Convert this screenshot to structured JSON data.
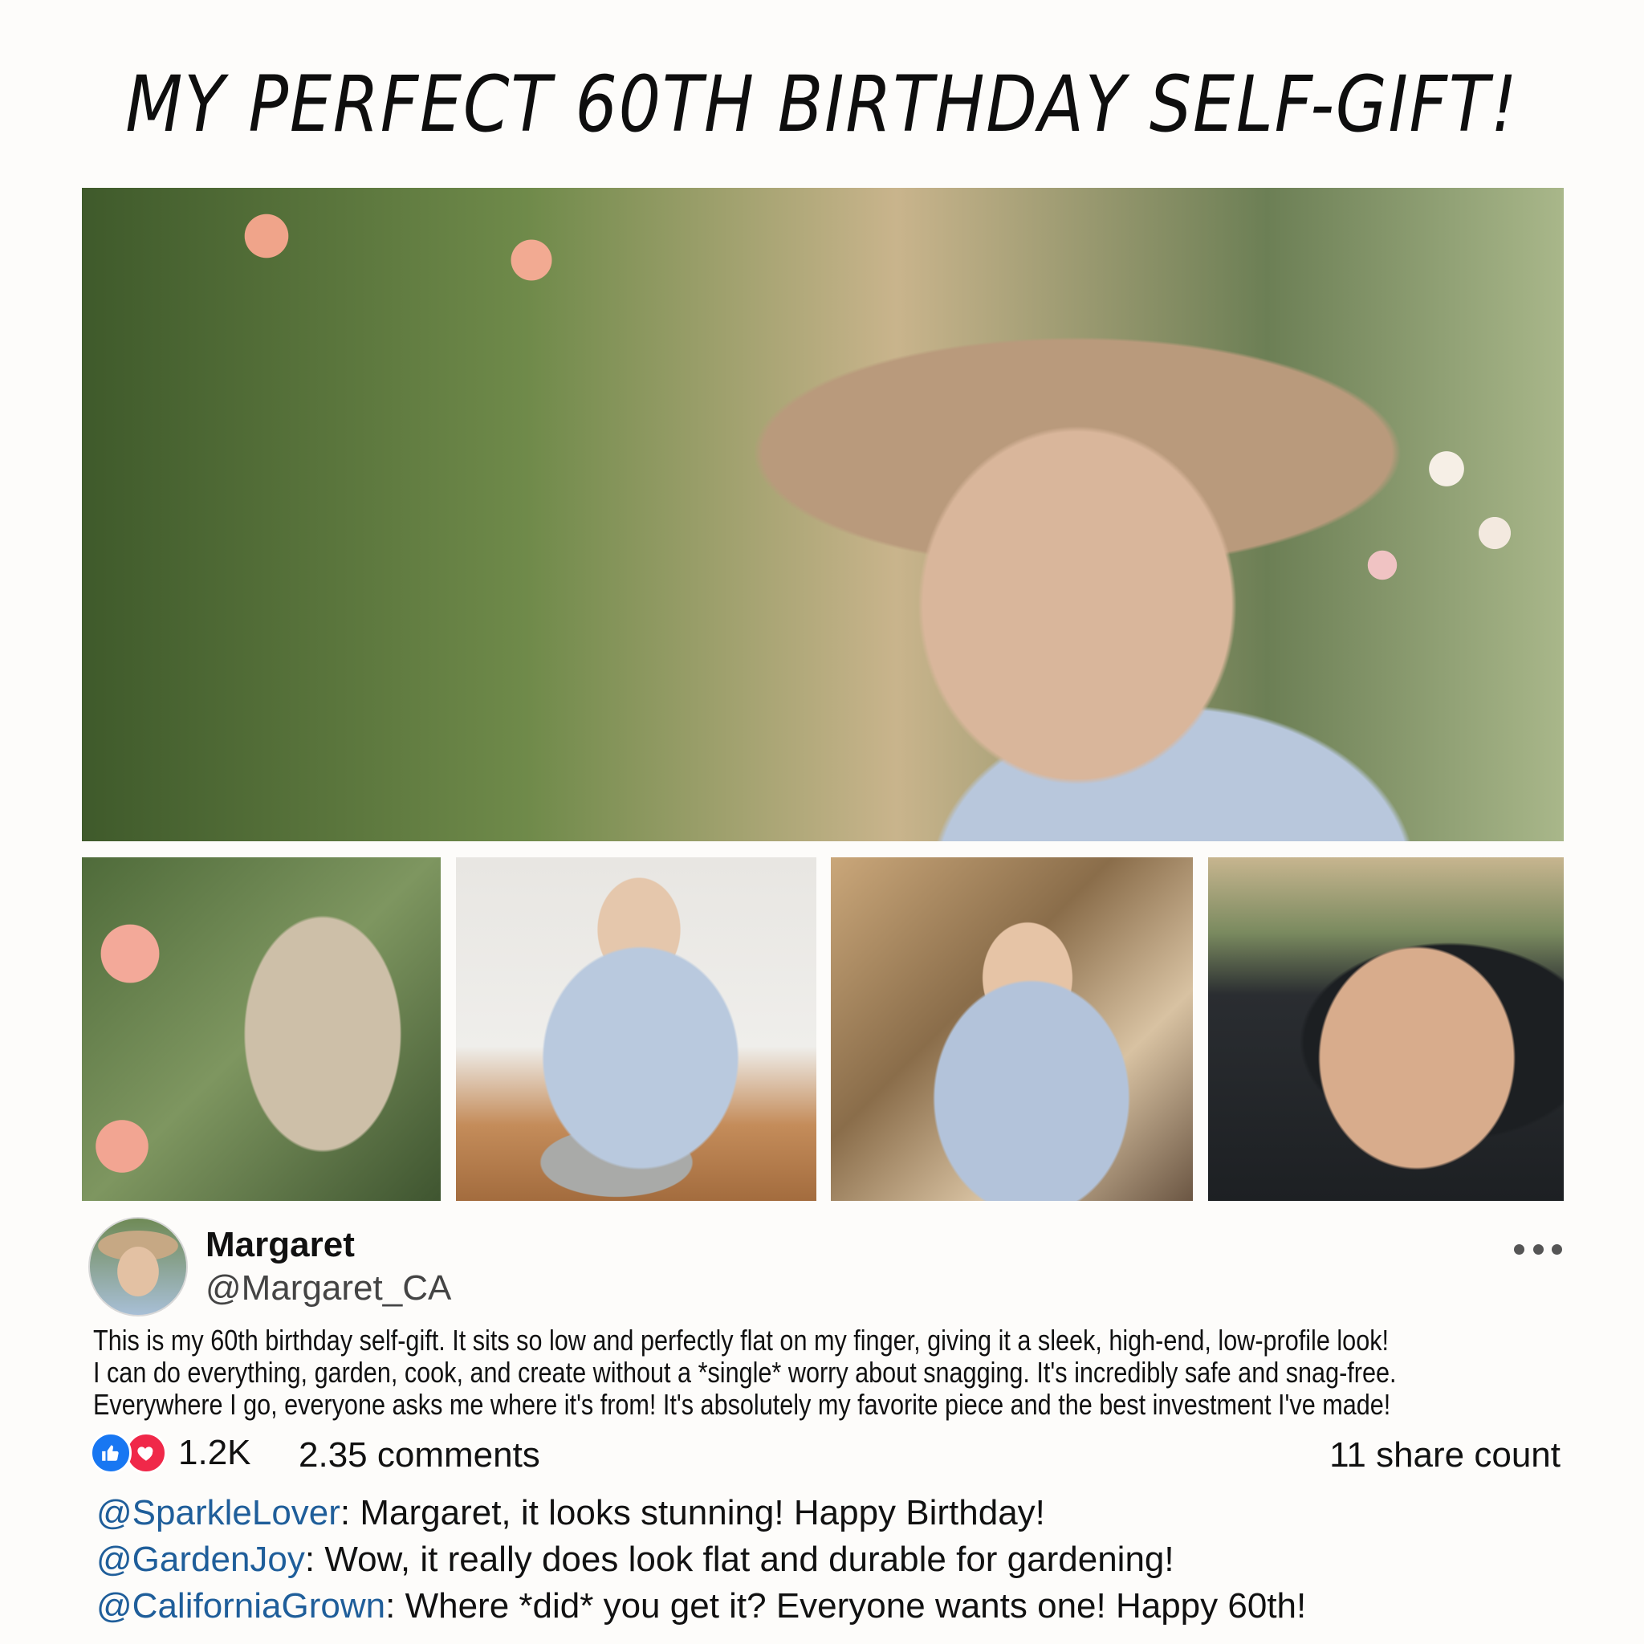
{
  "title": "MY PERFECT 60TH BIRTHDAY SELF-GIFT!",
  "post": {
    "author_name": "Margaret",
    "author_handle": "@Margaret_CA",
    "caption_lines": [
      "This is my 60th birthday self-gift. It sits so low and perfectly flat on my finger, giving it a sleek, high-end, low-profile look!",
      "I can do everything, garden, cook, and create without a *single* worry about snagging. It's incredibly safe and snag-free.",
      "Everywhere I go, everyone asks me where it's from! It's absolutely my favorite piece and the best investment I've made!"
    ],
    "likes": "1.2K",
    "comments_count": "2.35 comments",
    "shares": "11 share count"
  },
  "comments": [
    {
      "handle": "@SparkleLover",
      "text": ": Margaret, it looks stunning! Happy Birthday!"
    },
    {
      "handle": "@GardenJoy",
      "text": ": Wow, it really does look flat and durable for gardening!"
    },
    {
      "handle": "@CaliforniaGrown",
      "text": ": Where *did* you get it? Everyone wants one! Happy 60th!"
    }
  ],
  "icons": {
    "like": "thumbs-up-icon",
    "love": "heart-icon",
    "more": "more-options-icon"
  },
  "colors": {
    "like": "#1877f2",
    "love": "#f02849",
    "handle": "#1f5e9a"
  }
}
